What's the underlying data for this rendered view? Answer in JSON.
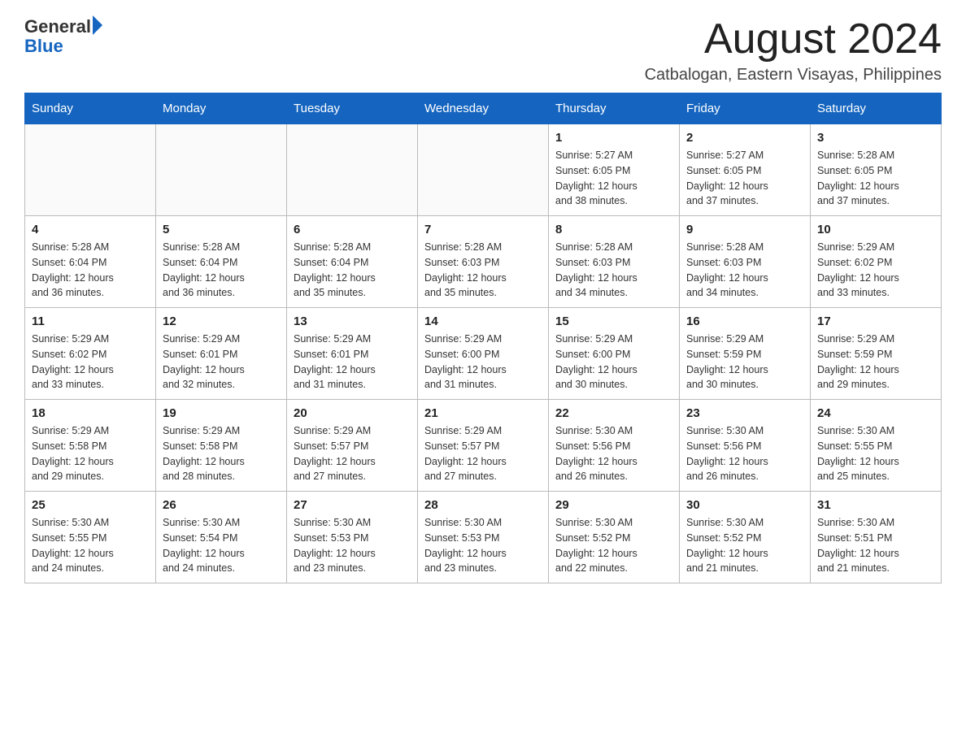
{
  "header": {
    "logo_general": "General",
    "logo_blue": "Blue",
    "month_title": "August 2024",
    "location": "Catbalogan, Eastern Visayas, Philippines"
  },
  "days_of_week": [
    "Sunday",
    "Monday",
    "Tuesday",
    "Wednesday",
    "Thursday",
    "Friday",
    "Saturday"
  ],
  "weeks": [
    [
      {
        "day": "",
        "info": ""
      },
      {
        "day": "",
        "info": ""
      },
      {
        "day": "",
        "info": ""
      },
      {
        "day": "",
        "info": ""
      },
      {
        "day": "1",
        "info": "Sunrise: 5:27 AM\nSunset: 6:05 PM\nDaylight: 12 hours\nand 38 minutes."
      },
      {
        "day": "2",
        "info": "Sunrise: 5:27 AM\nSunset: 6:05 PM\nDaylight: 12 hours\nand 37 minutes."
      },
      {
        "day": "3",
        "info": "Sunrise: 5:28 AM\nSunset: 6:05 PM\nDaylight: 12 hours\nand 37 minutes."
      }
    ],
    [
      {
        "day": "4",
        "info": "Sunrise: 5:28 AM\nSunset: 6:04 PM\nDaylight: 12 hours\nand 36 minutes."
      },
      {
        "day": "5",
        "info": "Sunrise: 5:28 AM\nSunset: 6:04 PM\nDaylight: 12 hours\nand 36 minutes."
      },
      {
        "day": "6",
        "info": "Sunrise: 5:28 AM\nSunset: 6:04 PM\nDaylight: 12 hours\nand 35 minutes."
      },
      {
        "day": "7",
        "info": "Sunrise: 5:28 AM\nSunset: 6:03 PM\nDaylight: 12 hours\nand 35 minutes."
      },
      {
        "day": "8",
        "info": "Sunrise: 5:28 AM\nSunset: 6:03 PM\nDaylight: 12 hours\nand 34 minutes."
      },
      {
        "day": "9",
        "info": "Sunrise: 5:28 AM\nSunset: 6:03 PM\nDaylight: 12 hours\nand 34 minutes."
      },
      {
        "day": "10",
        "info": "Sunrise: 5:29 AM\nSunset: 6:02 PM\nDaylight: 12 hours\nand 33 minutes."
      }
    ],
    [
      {
        "day": "11",
        "info": "Sunrise: 5:29 AM\nSunset: 6:02 PM\nDaylight: 12 hours\nand 33 minutes."
      },
      {
        "day": "12",
        "info": "Sunrise: 5:29 AM\nSunset: 6:01 PM\nDaylight: 12 hours\nand 32 minutes."
      },
      {
        "day": "13",
        "info": "Sunrise: 5:29 AM\nSunset: 6:01 PM\nDaylight: 12 hours\nand 31 minutes."
      },
      {
        "day": "14",
        "info": "Sunrise: 5:29 AM\nSunset: 6:00 PM\nDaylight: 12 hours\nand 31 minutes."
      },
      {
        "day": "15",
        "info": "Sunrise: 5:29 AM\nSunset: 6:00 PM\nDaylight: 12 hours\nand 30 minutes."
      },
      {
        "day": "16",
        "info": "Sunrise: 5:29 AM\nSunset: 5:59 PM\nDaylight: 12 hours\nand 30 minutes."
      },
      {
        "day": "17",
        "info": "Sunrise: 5:29 AM\nSunset: 5:59 PM\nDaylight: 12 hours\nand 29 minutes."
      }
    ],
    [
      {
        "day": "18",
        "info": "Sunrise: 5:29 AM\nSunset: 5:58 PM\nDaylight: 12 hours\nand 29 minutes."
      },
      {
        "day": "19",
        "info": "Sunrise: 5:29 AM\nSunset: 5:58 PM\nDaylight: 12 hours\nand 28 minutes."
      },
      {
        "day": "20",
        "info": "Sunrise: 5:29 AM\nSunset: 5:57 PM\nDaylight: 12 hours\nand 27 minutes."
      },
      {
        "day": "21",
        "info": "Sunrise: 5:29 AM\nSunset: 5:57 PM\nDaylight: 12 hours\nand 27 minutes."
      },
      {
        "day": "22",
        "info": "Sunrise: 5:30 AM\nSunset: 5:56 PM\nDaylight: 12 hours\nand 26 minutes."
      },
      {
        "day": "23",
        "info": "Sunrise: 5:30 AM\nSunset: 5:56 PM\nDaylight: 12 hours\nand 26 minutes."
      },
      {
        "day": "24",
        "info": "Sunrise: 5:30 AM\nSunset: 5:55 PM\nDaylight: 12 hours\nand 25 minutes."
      }
    ],
    [
      {
        "day": "25",
        "info": "Sunrise: 5:30 AM\nSunset: 5:55 PM\nDaylight: 12 hours\nand 24 minutes."
      },
      {
        "day": "26",
        "info": "Sunrise: 5:30 AM\nSunset: 5:54 PM\nDaylight: 12 hours\nand 24 minutes."
      },
      {
        "day": "27",
        "info": "Sunrise: 5:30 AM\nSunset: 5:53 PM\nDaylight: 12 hours\nand 23 minutes."
      },
      {
        "day": "28",
        "info": "Sunrise: 5:30 AM\nSunset: 5:53 PM\nDaylight: 12 hours\nand 23 minutes."
      },
      {
        "day": "29",
        "info": "Sunrise: 5:30 AM\nSunset: 5:52 PM\nDaylight: 12 hours\nand 22 minutes."
      },
      {
        "day": "30",
        "info": "Sunrise: 5:30 AM\nSunset: 5:52 PM\nDaylight: 12 hours\nand 21 minutes."
      },
      {
        "day": "31",
        "info": "Sunrise: 5:30 AM\nSunset: 5:51 PM\nDaylight: 12 hours\nand 21 minutes."
      }
    ]
  ]
}
